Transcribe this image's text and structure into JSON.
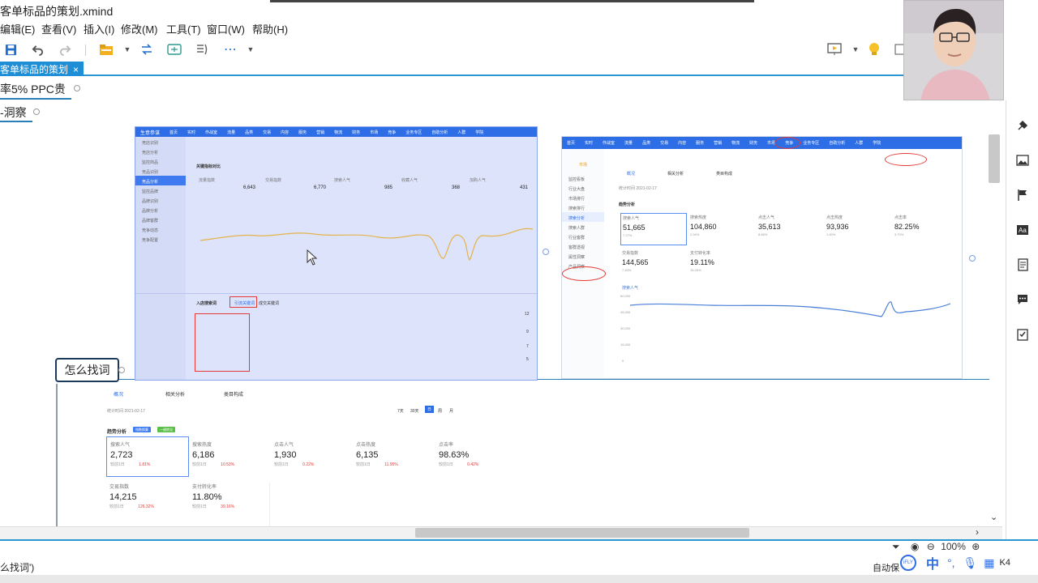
{
  "window": {
    "title": "客单标品的策划.xmind"
  },
  "menu": [
    "编辑(E)",
    "查看(V)",
    "插入(I)",
    "修改(M)",
    "工具(T)",
    "窗口(W)",
    "帮助(H)"
  ],
  "toolbar": {
    "icons": [
      "save-icon",
      "undo-icon",
      "redo-icon",
      "folder-icon",
      "dropdown-icon",
      "relationship-icon",
      "structure-icon",
      "summary-icon",
      "more-icon",
      "dropdown-icon"
    ]
  },
  "tab": {
    "label": "客单标品的策划",
    "close": "×"
  },
  "topics": {
    "t1": "率5% PPC贵",
    "t2": "-洞察",
    "main": "怎么找词"
  },
  "shot_a": {
    "logo": "生意参谋",
    "nav": [
      "首页",
      "实时",
      "作战室",
      "流量",
      "品类",
      "交易",
      "内容",
      "服务",
      "营销",
      "物流",
      "财务",
      "市场",
      "竞争",
      "业务专区",
      "自助分析",
      "人群",
      "学院"
    ],
    "sidebar": [
      "竞店识别",
      "竞店分析",
      "监控商品",
      "竞品识别",
      "竞品分析",
      "监控品牌",
      "品牌识别",
      "品牌分析",
      "品牌客群",
      "竞争动态",
      "竞争配置"
    ],
    "section1": "关键指标对比",
    "metrics": [
      {
        "label": "流量指数",
        "value": "6,643"
      },
      {
        "label": "交易指数",
        "value": "6,770"
      },
      {
        "label": "搜索人气",
        "value": "985"
      },
      {
        "label": "收藏人气",
        "value": "368"
      },
      {
        "label": "加购人气",
        "value": "431"
      }
    ],
    "section2": "入店搜索词",
    "tabs2": [
      "引流关键词",
      "成交关键词"
    ],
    "x_ticks": [
      "01-19",
      "01-21",
      "01-23",
      "01-25",
      "01-27",
      "01-29",
      "01-31",
      "02-02",
      "02-04",
      "02-06",
      "02-08",
      "02-10",
      "02-12",
      "02-14",
      "02-17"
    ],
    "right_values": [
      "12",
      "9",
      "7",
      "5"
    ]
  },
  "shot_b": {
    "nav": [
      "首页",
      "实时",
      "作战室",
      "流量",
      "品类",
      "交易",
      "内容",
      "服务",
      "营销",
      "物流",
      "财务",
      "市场",
      "竞争",
      "业务专区",
      "自助分析",
      "人群",
      "学院"
    ],
    "market_label": "市场",
    "tabs": [
      "概况",
      "相关分析",
      "类目构成"
    ],
    "date": "统计时间 2021-02-17",
    "section": "趋势分析",
    "cards": [
      {
        "label": "搜索人气",
        "value": "51,665",
        "delta": "7.27%"
      },
      {
        "label": "搜索热度",
        "value": "104,860",
        "delta": "2.94%"
      },
      {
        "label": "点击人气",
        "value": "35,613",
        "delta": "8.66%"
      },
      {
        "label": "点击热度",
        "value": "93,936",
        "delta": "1.40%"
      },
      {
        "label": "点击率",
        "value": "82.25%",
        "delta": "3.70%"
      },
      {
        "label": "交易指数",
        "value": "144,565",
        "delta": "7.43%"
      },
      {
        "label": "支付转化率",
        "value": "19.11%",
        "delta": "15.26%"
      }
    ],
    "sidebar": [
      "监控看板",
      "行业大盘",
      "市场排行",
      "搜索排行",
      "搜索分析",
      "搜索人群",
      "行业客群",
      "客群透视",
      "属性洞察",
      "产品洞察"
    ],
    "y_ticks": [
      "60,000",
      "45,000",
      "30,000",
      "15,000",
      "0"
    ],
    "legend": "搜索人气"
  },
  "shot_c": {
    "tabs": [
      "概况",
      "相关分析",
      "类目构成"
    ],
    "date": "统计时间 2021-02-17",
    "ranges": [
      "7天",
      "30天",
      "日",
      "周",
      "月"
    ],
    "section": "趋势分析",
    "badges": [
      "指数换算",
      "一键转化"
    ],
    "cards": [
      {
        "label": "搜索人气",
        "value": "2,723",
        "delta": "1.81%"
      },
      {
        "label": "搜索热度",
        "value": "6,186",
        "delta": "10.53%"
      },
      {
        "label": "点击人气",
        "value": "1,930",
        "delta": "0.22%"
      },
      {
        "label": "点击热度",
        "value": "6,135",
        "delta": "11.95%"
      },
      {
        "label": "点击率",
        "value": "98.63%",
        "delta": "0.42%"
      },
      {
        "label": "交易指数",
        "value": "14,215",
        "delta": "126.32%"
      },
      {
        "label": "支付转化率",
        "value": "11.80%",
        "delta": "39.16%"
      }
    ],
    "compare": "较前1日"
  },
  "statusbar": {
    "text": "么找词')",
    "zoom": "100%",
    "auto": "自动保",
    "ime": "中",
    "keyboard": "K4"
  },
  "right_panel": [
    "format-icon",
    "image-icon",
    "marker-icon",
    "textstyle-icon",
    "notes-icon",
    "comment-icon",
    "task-icon"
  ]
}
